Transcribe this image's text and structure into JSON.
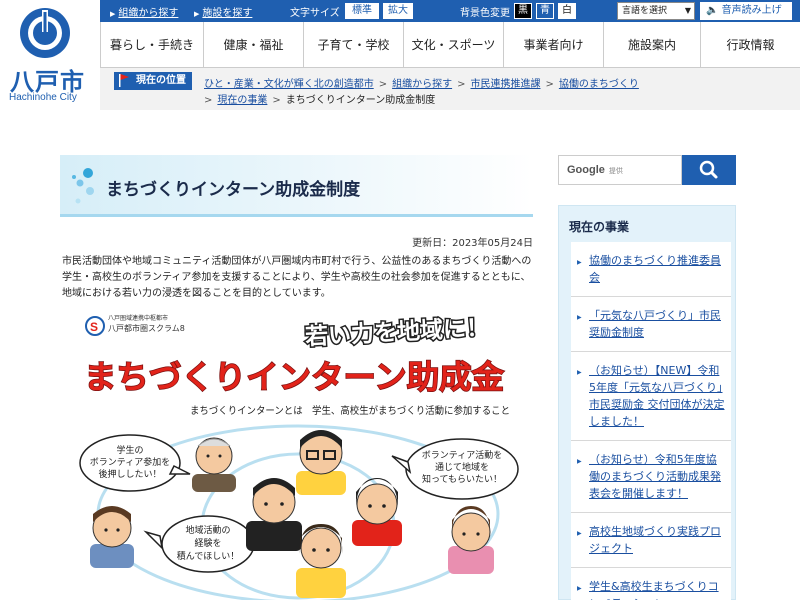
{
  "site": {
    "logo_text": "八戸市",
    "logo_sub": "Hachinohe City"
  },
  "topbar": {
    "link_org": "組織から探す",
    "link_facility": "施設を探す",
    "font_size_label": "文字サイズ",
    "font_standard": "標準",
    "font_large": "拡大",
    "bg_color_label": "背景色変更",
    "bg_black": "黒",
    "bg_blue": "青",
    "bg_white": "白",
    "language_select": "言語を選択",
    "read_aloud": "音声読み上げ"
  },
  "nav": {
    "items": [
      "暮らし・手続き",
      "健康・福祉",
      "子育て・学校",
      "文化・スポーツ",
      "事業者向け",
      "施設案内",
      "行政情報"
    ]
  },
  "breadcrumb": {
    "label": "現在の位置",
    "items": [
      "ひと・産業・文化が輝く北の創造都市",
      "組織から探す",
      "市民連携推進課",
      "協働のまちづくり",
      "現在の事業"
    ],
    "current": "まちづくりインターン助成金制度"
  },
  "main": {
    "title": "まちづくりインターン助成金制度",
    "updated": "更新日：2023年05月24日",
    "intro": "市民活動団体や地域コミュニティ活動団体が八戸圏域内市町村で行う、公益性のあるまちづくり活動への学生・高校生のボランティア参加を支援することにより、学生や高校生の社会参加を促進するとともに、地域における若い力の浸透を図ることを目的としています。"
  },
  "poster": {
    "org_line1": "八戸圏域連携中枢都市",
    "org_line2": "八戸都市圏スクラム8",
    "slogan": "若い力を地域に！",
    "headline": "まちづくりインターン助成金",
    "definition": "まちづくりインターンとは　学生、高校生がまちづくり活動に参加すること",
    "bubble1": [
      "学生の",
      "ボランティア参加を",
      "後押ししたい！"
    ],
    "bubble2": [
      "ボランティア活動を",
      "通じて地域を",
      "知ってもらいたい！"
    ],
    "bubble3": [
      "地域活動の",
      "経験を",
      "積んでほしい！"
    ]
  },
  "search": {
    "brand": "Google",
    "placeholder": "提供"
  },
  "sidebar": {
    "title": "現在の事業",
    "items": [
      "協働のまちづくり推進委員会",
      "「元気な八戸づくり」市民奨励金制度",
      "（お知らせ）【NEW】令和5年度「元気な八戸づくり」市民奨励金 交付団体が決定しました！",
      "（お知らせ）令和5年度協働のまちづくり活動成果発表会を開催します！",
      "高校生地域づくり実践プロジェクト",
      "学生&高校生まちづくりコンペティション"
    ]
  },
  "colors": {
    "brand_blue": "#1f5fb0",
    "headline_red": "#e2231a",
    "side_bg": "#e3f2fa"
  }
}
